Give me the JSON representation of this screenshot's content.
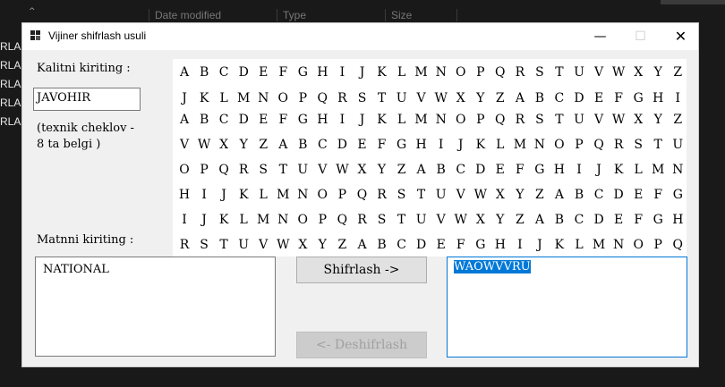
{
  "background": {
    "columns": [
      "Date modified",
      "Type",
      "Size"
    ],
    "rows": [
      "RLAS",
      "RLAS",
      "RLAS",
      "RLAS",
      "RLAS"
    ]
  },
  "window": {
    "title": "Vijiner shifrlash usuli",
    "minimize_glyph": "—",
    "maximize_glyph": "☐",
    "close_glyph": "✕"
  },
  "form": {
    "key_label": "Kalitni kiriting :",
    "key_value": "JAVOHIR",
    "key_note_line1": "(texnik cheklov -",
    "key_note_line2": "8 ta belgi )",
    "text_label": "Matnni kiriting :",
    "input_text": "NATIONAL",
    "encrypt_button": "Shifrlash ->",
    "decrypt_button": "<- Deshifrlash",
    "output_text": "WAOWVVRU"
  },
  "vigenere_table": [
    "ABCDEFGHIJKLMNOPQRSTUVWXYZ",
    "JKLMNOPQRSTUVWXYZABCDEFGHI",
    "ABCDEFGHIJKLMNOPQRSTUVWXYZ",
    "VWXYZABCDEFGHIJKLMNOPQRSTU",
    "OPQRSTUVWXYZABCDEFGHIJKLMN",
    "HIJKLMNOPQRSTUVWXYZABCDEFG",
    "IJKLMNOPQRSTUVWXYZABCDEFGH",
    "RSTUVWXYZABCDEFGHIJKLMNOPQ"
  ]
}
